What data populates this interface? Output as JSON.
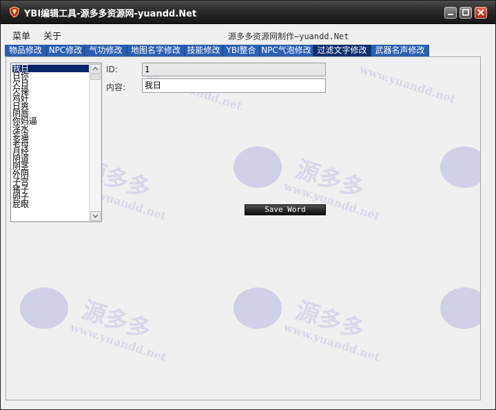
{
  "window": {
    "title": "YBI编辑工具-源多多资源网-yuandd.Net"
  },
  "menubar": {
    "items": [
      "菜单",
      "关于"
    ],
    "caption": "源多多资源网制作—yuandd.Net"
  },
  "tabs": [
    {
      "label": "物品修改"
    },
    {
      "label": "NPC修改"
    },
    {
      "label": "气功修改"
    },
    {
      "label": "地图名字修改"
    },
    {
      "label": "技能修改"
    },
    {
      "label": "YBI整合"
    },
    {
      "label": "NPC气泡修改"
    },
    {
      "label": "过滤文字修改",
      "active": true
    },
    {
      "label": "武器名声修改"
    }
  ],
  "word_list": {
    "items": [
      "我日",
      "日你",
      "欠日",
      "欠操",
      "鸡奸",
      "日爽",
      "阴唇",
      "你妈逼",
      "淫水",
      "妄逼",
      "老母",
      "月经",
      "阴道",
      "阴茎",
      "外阴",
      "子宫",
      "猪子",
      "卵子",
      "屁眼"
    ],
    "selected_index": 0
  },
  "form": {
    "id_label": "ID:",
    "id_value": "1",
    "content_label": "内容:",
    "content_value": "我日"
  },
  "save_button": {
    "label": "Save Word"
  },
  "watermark": {
    "text_cn": "源多多",
    "text_url": "www.yuandd.net",
    "text_small": "YUANDD.NET"
  },
  "colors": {
    "titlebar": "#1f1f1f",
    "tab": "#2b5fb1",
    "tab_active": "#0e2f6e",
    "selection": "#0a246a",
    "close_button": "#c4321f"
  },
  "icons": {
    "app": "shield-icon",
    "minimize": "minimize-icon",
    "maximize": "maximize-icon",
    "close": "close-icon"
  }
}
